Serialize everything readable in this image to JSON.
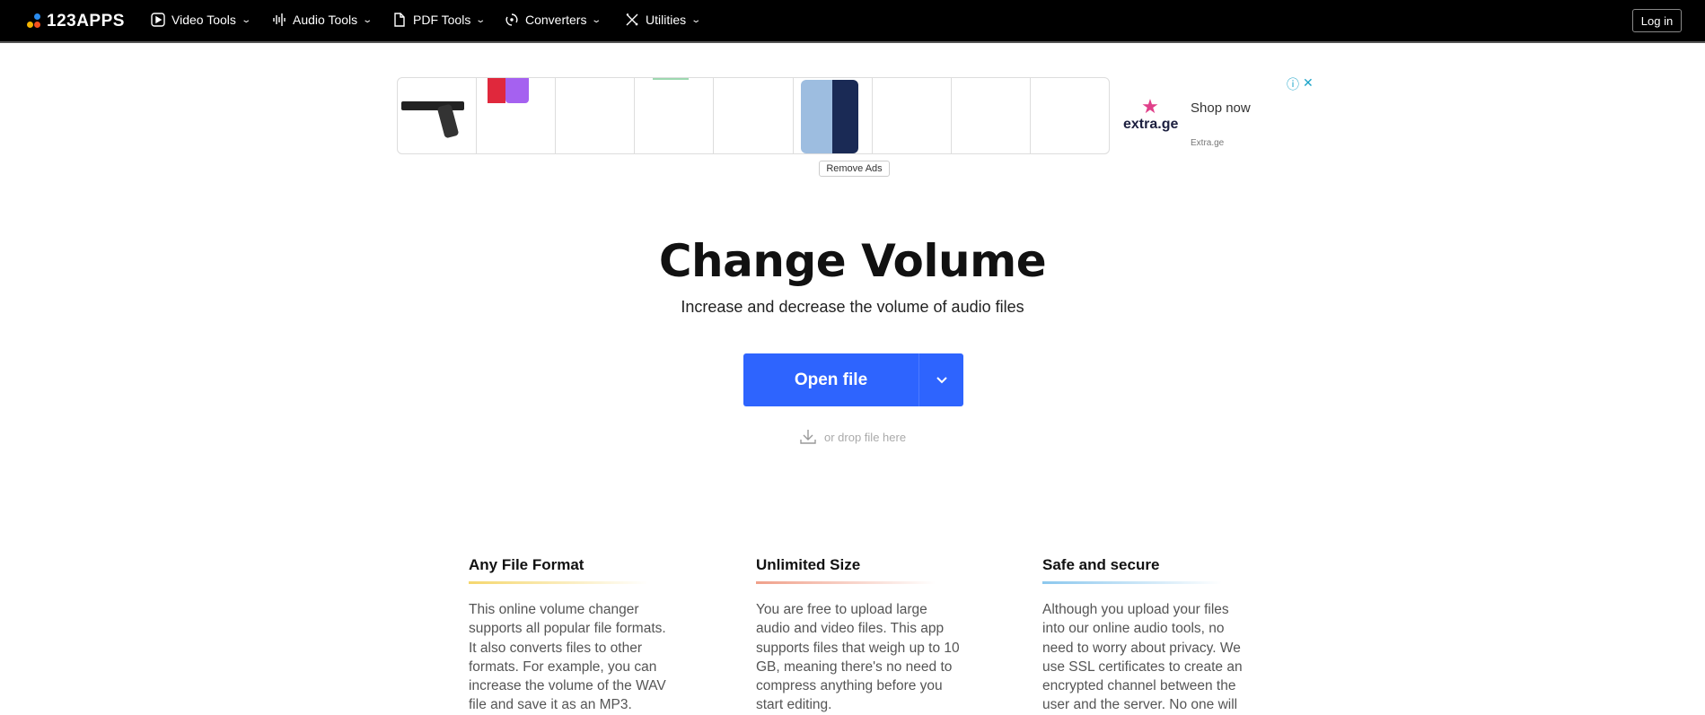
{
  "nav": {
    "logo": "123APPS",
    "items": [
      {
        "label": "Video Tools",
        "icon": "play-icon"
      },
      {
        "label": "Audio Tools",
        "icon": "waveform-icon"
      },
      {
        "label": "PDF Tools",
        "icon": "document-icon"
      },
      {
        "label": "Converters",
        "icon": "convert-icon"
      },
      {
        "label": "Utilities",
        "icon": "tools-icon"
      }
    ],
    "login": "Log in"
  },
  "ad": {
    "brand": "extra.ge",
    "cta": "Shop now",
    "source": "Extra.ge",
    "remove": "Remove Ads"
  },
  "hero": {
    "title": "Change Volume",
    "subtitle": "Increase and decrease the volume of audio files",
    "open_button": "Open file",
    "drop_text": "or drop file here",
    "accent": "#2e64fe"
  },
  "features": [
    {
      "title": "Any File Format",
      "color": "#f5d76e",
      "text": "This online volume changer supports all popular file formats. It also converts files to other formats. For example, you can increase the volume of the WAV file and save it as an MP3."
    },
    {
      "title": "Unlimited Size",
      "color": "#f0a08a",
      "text": "You are free to upload large audio and video files. This app supports files that weigh up to 10 GB, meaning there's no need to compress anything before you start editing."
    },
    {
      "title": "Safe and secure",
      "color": "#8cc8ee",
      "text": "Although you upload your files into our online audio tools, no need to worry about privacy. We use SSL certificates to create an encrypted channel between the user and the server. No one will"
    }
  ]
}
